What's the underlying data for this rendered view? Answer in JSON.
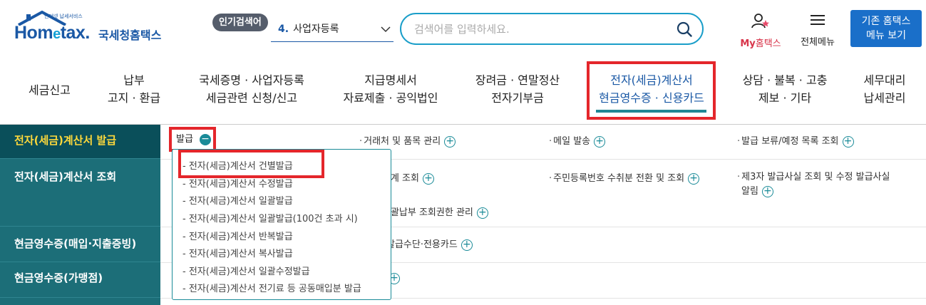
{
  "brand": {
    "small_text": "인터넷 납세서비스",
    "logo_text_a": "Hom",
    "logo_text_e": "e",
    "logo_text_b": "tax.",
    "name": "국세청홈택스"
  },
  "popular_search": {
    "badge": "인기검색어",
    "rank": "4.",
    "term": "사업자등록"
  },
  "search": {
    "placeholder": "검색어를 입력하세요."
  },
  "header_actions": {
    "my_prefix": "My",
    "my_suffix": "홈택스",
    "all_menu": "전체메뉴",
    "classic_line1": "기존 홈택스",
    "classic_line2": "메뉴 보기"
  },
  "nav": [
    {
      "line1": "세금신고",
      "line2": ""
    },
    {
      "line1": "납부",
      "line2": "고지 · 환급"
    },
    {
      "line1": "국세증명 · 사업자등록",
      "line2": "세금관련 신청/신고"
    },
    {
      "line1": "지급명세서",
      "line2": "자료제출 · 공익법인"
    },
    {
      "line1": "장려금 · 연말정산",
      "line2": "전자기부금"
    },
    {
      "line1": "전자(세금)계산서",
      "line2": "현금영수증 · 신용카드"
    },
    {
      "line1": "상담 · 불복 · 고충",
      "line2": "제보 · 기타"
    },
    {
      "line1": "세무대리",
      "line2": "납세관리"
    }
  ],
  "left_menu": [
    "전자(세금)계산서 발급",
    "전자(세금)계산서 조회",
    "현금영수증(매입·지출증빙)",
    "현금영수증(가맹점)"
  ],
  "issue_toggle": {
    "label": "발급",
    "icon": "minus-circle-icon"
  },
  "links": {
    "client_items": "거래처 및 품목 관리",
    "mail_send": "메일 발송",
    "hold_list": "발급 보류/예정 목록 조회",
    "stats_view": "통계 조회",
    "resident_conv": "주민등록번호 수취분 전환 및 조회",
    "third_party_line1": "제3자 발급사실 조회 및 수정 발급사실",
    "third_party_line2": "알림",
    "bulk_payment": "총괄납부 조회권한 관리",
    "payment_card": "발급수단·전용카드"
  },
  "dropdown": [
    "전자(세금)계산서 건별발급",
    "전자(세금)계산서 수정발급",
    "전자(세금)계산서 일괄발급",
    "전자(세금)계산서 일괄발급(100건 초과 시)",
    "전자(세금)계산서 반복발급",
    "전자(세금)계산서 복사발급",
    "전자(세금)계산서 일괄수정발급",
    "전자(세금)계산서 전기료 등 공동매입분 발급"
  ],
  "colors": {
    "brand_blue": "#1a58a5",
    "teal": "#1c6e78",
    "highlight_red": "#e4262b",
    "active_yellow": "#ffd93b"
  }
}
